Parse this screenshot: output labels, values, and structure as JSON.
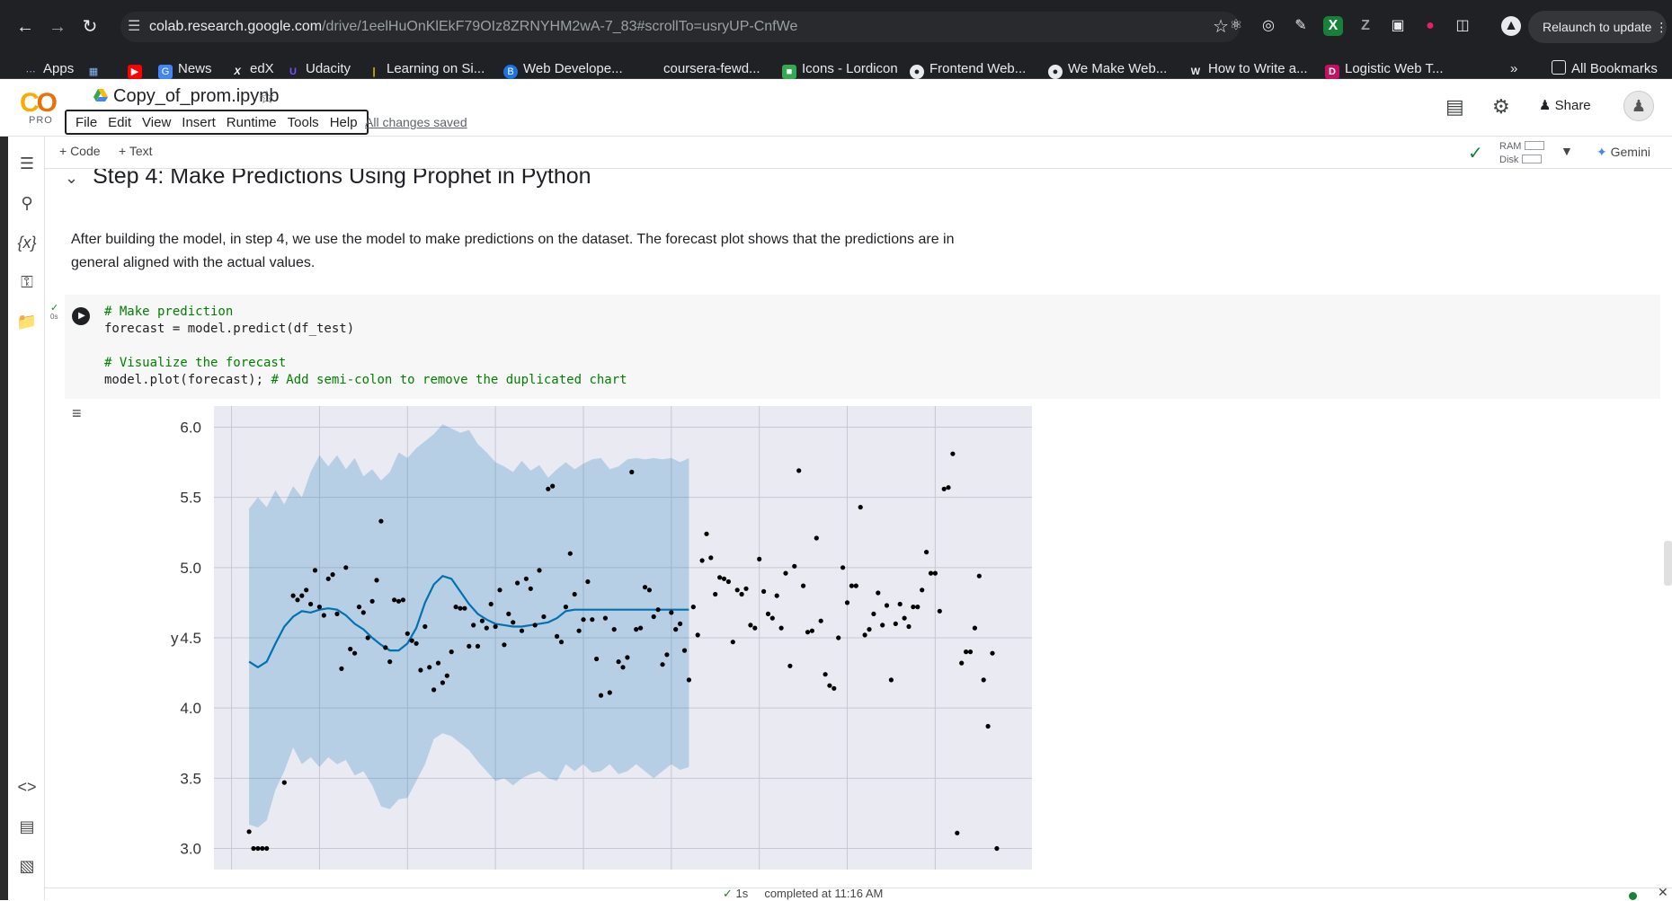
{
  "browser": {
    "url_host": "colab.research.google.com",
    "url_rest": "/drive/1eelHuOnKlEkF79OIz8ZRNYHM2wA-7_83#scrollTo=usryUP-CnfWe",
    "relaunch_label": "Relaunch to update",
    "bookmarks": [
      {
        "label": "Apps",
        "icon": "apps-grid-icon",
        "color": "#8ab4f8"
      },
      {
        "label": "",
        "icon": "grid-icon",
        "color": "#8ab4f8"
      },
      {
        "label": "",
        "icon": "youtube-icon",
        "color": "#ff0000"
      },
      {
        "label": "News",
        "icon": "news-icon",
        "color": "#4285f4"
      },
      {
        "label": "edX",
        "icon": "edx-icon",
        "color": "#ffffff"
      },
      {
        "label": "Udacity",
        "icon": "udacity-icon",
        "color": "#7c4dff"
      },
      {
        "label": "Learning on Si...",
        "icon": "learning-icon",
        "color": "#fbbc04"
      },
      {
        "label": "Web Develope...",
        "icon": "web-dev-icon",
        "color": "#1a73e8"
      },
      {
        "label": "coursera-fewd...",
        "icon": "github-icon",
        "color": "#202124"
      },
      {
        "label": "Icons - Lordicon",
        "icon": "lordicon-icon",
        "color": "#34a853"
      },
      {
        "label": "Frontend Web...",
        "icon": "globe-icon",
        "color": "#e8eaed"
      },
      {
        "label": "We Make Web...",
        "icon": "globe-icon",
        "color": "#e8eaed"
      },
      {
        "label": "How to Write a...",
        "icon": "w-icon",
        "color": "#e8eaed"
      },
      {
        "label": "Logistic Web T...",
        "icon": "d-icon",
        "color": "#c51162"
      }
    ],
    "all_bookmarks_label": "All Bookmarks"
  },
  "colab": {
    "logo_text": "CO",
    "pro_label": "PRO",
    "notebook_title": "Copy_of_prom.ipynb",
    "menu": [
      "File",
      "Edit",
      "View",
      "Insert",
      "Runtime",
      "Tools",
      "Help"
    ],
    "saved_status": "All changes saved",
    "share_label": "Share"
  },
  "toolbar": {
    "add_code_label": "+ Code",
    "add_text_label": "+ Text",
    "ram_label": "RAM",
    "disk_label": "Disk",
    "gemini_label": "Gemini"
  },
  "notebook": {
    "section_heading": "Step 4: Make Predictions Using Prophet in Python",
    "paragraph": "After building the model, in step 4, we use the model to make predictions on the dataset. The forecast plot shows that the predictions are in general aligned with the actual values.",
    "exec_time": "0s",
    "code_lines": [
      {
        "text": "# Make prediction",
        "type": "comment"
      },
      {
        "text": "forecast = model.predict(df_test)",
        "type": "code"
      },
      {
        "text": "",
        "type": "code"
      },
      {
        "text": "# Visualize the forecast",
        "type": "comment"
      },
      {
        "text": "model.plot(forecast); ",
        "type": "code",
        "trailing_comment": "# Add semi-colon to remove the duplicated chart"
      }
    ]
  },
  "status_bar": {
    "exec_check": "✓",
    "duration": "1s",
    "completed_text": "completed at 11:16 AM"
  },
  "chart_data": {
    "type": "line",
    "xlabel": "",
    "ylabel": "y",
    "ylim": [
      2.85,
      6.15
    ],
    "yticks": [
      3.0,
      3.5,
      4.0,
      4.5,
      5.0,
      5.5,
      6.0
    ],
    "x_range": [
      0,
      186
    ],
    "x_grid": [
      4,
      24,
      44,
      64,
      84,
      104,
      124,
      144,
      164
    ],
    "grid": true,
    "background": "#eaeaf2",
    "forecast_line_color": "#0072b2",
    "interval_color": "#0072b2",
    "point_color": "#000000",
    "series": [
      {
        "name": "yhat",
        "x": [
          8,
          10,
          12,
          14,
          16,
          18,
          20,
          22,
          24,
          26,
          28,
          30,
          32,
          34,
          36,
          38,
          40,
          42,
          44,
          46,
          48,
          50,
          52,
          54,
          56,
          58,
          60,
          62,
          64,
          66,
          68,
          70,
          72,
          74,
          76,
          78,
          80,
          82,
          84,
          86,
          88,
          90,
          92,
          94,
          96,
          98,
          100,
          102,
          104,
          106,
          108
        ],
        "values": [
          4.33,
          4.29,
          4.33,
          4.46,
          4.58,
          4.65,
          4.69,
          4.68,
          4.7,
          4.71,
          4.7,
          4.66,
          4.6,
          4.56,
          4.5,
          4.45,
          4.41,
          4.41,
          4.46,
          4.57,
          4.75,
          4.88,
          4.94,
          4.92,
          4.83,
          4.74,
          4.67,
          4.63,
          4.6,
          4.59,
          4.58,
          4.58,
          4.59,
          4.6,
          4.61,
          4.64,
          4.69,
          4.7,
          4.7,
          4.7,
          4.7,
          4.7,
          4.7,
          4.7,
          4.7,
          4.7,
          4.7,
          4.7,
          4.7,
          4.7,
          4.7
        ]
      },
      {
        "name": "yhat_upper",
        "x": [
          8,
          10,
          12,
          14,
          16,
          18,
          20,
          22,
          24,
          26,
          28,
          30,
          32,
          34,
          36,
          38,
          40,
          42,
          44,
          46,
          48,
          50,
          52,
          54,
          56,
          58,
          60,
          62,
          64,
          66,
          68,
          70,
          72,
          74,
          76,
          78,
          80,
          82,
          84,
          86,
          88,
          90,
          92,
          94,
          96,
          98,
          100,
          102,
          104,
          106,
          108
        ],
        "values": [
          5.42,
          5.5,
          5.43,
          5.55,
          5.45,
          5.58,
          5.5,
          5.68,
          5.8,
          5.72,
          5.8,
          5.7,
          5.78,
          5.65,
          5.7,
          5.62,
          5.68,
          5.82,
          5.78,
          5.85,
          5.9,
          5.95,
          6.02,
          5.99,
          5.96,
          5.98,
          5.88,
          5.82,
          5.75,
          5.72,
          5.68,
          5.76,
          5.69,
          5.73,
          5.64,
          5.7,
          5.75,
          5.7,
          5.74,
          5.77,
          5.78,
          5.7,
          5.72,
          5.77,
          5.78,
          5.77,
          5.78,
          5.77,
          5.78,
          5.75,
          5.78
        ]
      },
      {
        "name": "yhat_lower",
        "x": [
          8,
          10,
          12,
          14,
          16,
          18,
          20,
          22,
          24,
          26,
          28,
          30,
          32,
          34,
          36,
          38,
          40,
          42,
          44,
          46,
          48,
          50,
          52,
          54,
          56,
          58,
          60,
          62,
          64,
          66,
          68,
          70,
          72,
          74,
          76,
          78,
          80,
          82,
          84,
          86,
          88,
          90,
          92,
          94,
          96,
          98,
          100,
          102,
          104,
          106,
          108
        ],
        "values": [
          3.17,
          3.15,
          3.2,
          3.42,
          3.55,
          3.72,
          3.6,
          3.65,
          3.58,
          3.65,
          3.6,
          3.63,
          3.52,
          3.55,
          3.45,
          3.3,
          3.28,
          3.35,
          3.36,
          3.48,
          3.6,
          3.78,
          3.82,
          3.8,
          3.75,
          3.7,
          3.62,
          3.55,
          3.48,
          3.5,
          3.45,
          3.5,
          3.53,
          3.55,
          3.5,
          3.48,
          3.6,
          3.55,
          3.6,
          3.54,
          3.55,
          3.6,
          3.53,
          3.55,
          3.6,
          3.55,
          3.5,
          3.55,
          3.6,
          3.56,
          3.58
        ]
      },
      {
        "name": "actual",
        "x": [
          8,
          9,
          10,
          11,
          12,
          16,
          18,
          19,
          20,
          21,
          22,
          23,
          24,
          25,
          26,
          27,
          28,
          29,
          30,
          31,
          32,
          33,
          34,
          35,
          36,
          37,
          38,
          39,
          40,
          41,
          42,
          43,
          44,
          45,
          46,
          47,
          48,
          49,
          50,
          51,
          52,
          53,
          54,
          55,
          56,
          57,
          58,
          59,
          60,
          61,
          62,
          63,
          64,
          65,
          66,
          67,
          68,
          69,
          70,
          71,
          72,
          73,
          74,
          75,
          76,
          77,
          78,
          79,
          80,
          81,
          82,
          83,
          84,
          85,
          86,
          87,
          88,
          89,
          90,
          91,
          92,
          93,
          94,
          95,
          96,
          97,
          98,
          99,
          100,
          101,
          102,
          103,
          104,
          105,
          106,
          107,
          108,
          109,
          110,
          111,
          112,
          113,
          114,
          115,
          116,
          117,
          118,
          119,
          120,
          121,
          122,
          123,
          124,
          125,
          126,
          127,
          128,
          129,
          130,
          131,
          132,
          133,
          134,
          135,
          136,
          137,
          138,
          139,
          140,
          141,
          142,
          143,
          144,
          145,
          146,
          147,
          148,
          149,
          150,
          151,
          152,
          153,
          154,
          155,
          156,
          157,
          158,
          159,
          160,
          161,
          162,
          163,
          164,
          165,
          166,
          167,
          168,
          169,
          170,
          171,
          172,
          173,
          174,
          175,
          176,
          177,
          178
        ],
        "values": [
          3.12,
          3.0,
          3.0,
          3.0,
          3.0,
          3.47,
          4.8,
          4.77,
          4.8,
          4.84,
          4.74,
          4.98,
          4.72,
          4.66,
          4.92,
          4.95,
          4.67,
          4.28,
          5.0,
          4.42,
          4.39,
          4.72,
          4.68,
          4.5,
          4.76,
          4.91,
          5.33,
          4.43,
          4.33,
          4.77,
          4.76,
          4.77,
          4.53,
          4.48,
          4.46,
          4.27,
          4.58,
          4.29,
          4.13,
          4.32,
          4.18,
          4.23,
          4.4,
          4.72,
          4.71,
          4.71,
          4.44,
          4.59,
          4.44,
          4.62,
          4.57,
          4.74,
          4.58,
          4.84,
          4.45,
          4.67,
          4.61,
          4.89,
          4.55,
          4.92,
          4.85,
          4.59,
          4.98,
          4.65,
          5.56,
          5.58,
          4.51,
          4.47,
          4.72,
          5.1,
          4.81,
          4.55,
          4.63,
          4.9,
          4.63,
          4.35,
          4.09,
          4.64,
          4.11,
          4.56,
          4.33,
          4.29,
          4.36,
          5.68,
          4.56,
          4.57,
          4.86,
          4.84,
          4.65,
          4.7,
          4.31,
          4.38,
          4.68,
          4.56,
          4.6,
          4.41,
          4.2,
          4.72,
          4.52,
          5.05,
          5.24,
          5.07,
          4.81,
          4.93,
          4.92,
          4.9,
          4.47,
          4.84,
          4.81,
          4.85,
          4.59,
          4.57,
          5.06,
          4.83,
          4.67,
          4.64,
          4.8,
          4.57,
          4.96,
          4.3,
          5.01,
          5.69,
          4.87,
          4.54,
          4.55,
          5.21,
          4.62,
          4.24,
          4.16,
          4.14,
          4.5,
          5.0,
          4.75,
          4.87,
          4.87,
          5.43,
          4.52,
          4.56,
          4.67,
          4.82,
          4.59,
          4.73,
          4.2,
          4.6,
          4.74,
          4.64,
          4.58,
          4.72,
          4.72,
          4.84,
          5.11,
          4.96,
          4.96,
          4.69,
          5.56,
          5.57,
          5.81,
          3.11,
          4.32,
          4.4,
          4.4,
          4.57,
          4.94,
          4.2,
          3.87,
          4.39,
          3.0
        ]
      }
    ]
  }
}
